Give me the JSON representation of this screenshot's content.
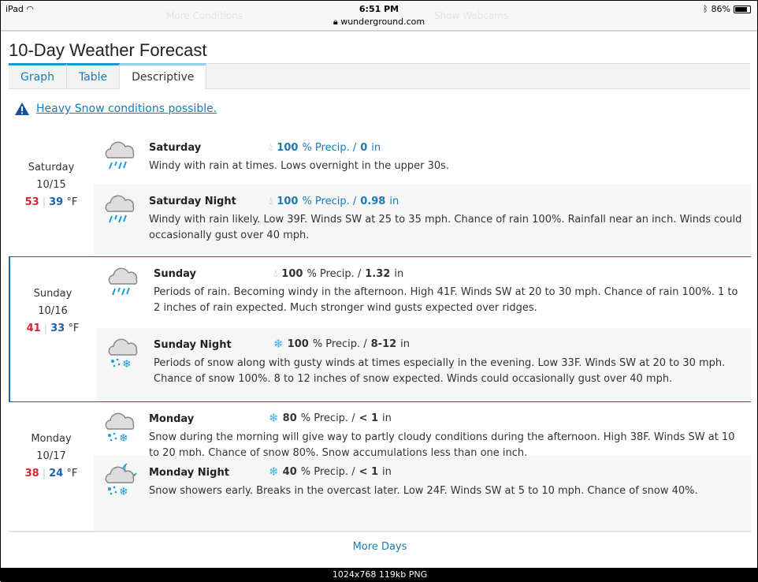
{
  "status_bar": {
    "device": "iPad",
    "time": "6:51 PM",
    "url": "wunderground.com",
    "battery": "86%",
    "battery_level": 0.86,
    "ghost_left": "More Conditions",
    "ghost_right": "Show Webcams"
  },
  "page_title": "10-Day Weather Forecast",
  "tabs": [
    {
      "label": "Graph"
    },
    {
      "label": "Table"
    },
    {
      "label": "Descriptive",
      "active": true
    }
  ],
  "alert": {
    "text": "Heavy Snow conditions possible.",
    "icon": "warning-triangle-icon"
  },
  "colors": {
    "accent": "#1a7ab5",
    "high": "#d8232a",
    "low": "#1a64b5",
    "rain": "#1a9bd7"
  },
  "days": [
    {
      "name": "Saturday",
      "date": "10/15",
      "high": "53",
      "low": "39",
      "unit": "°F",
      "selected": false,
      "periods": [
        {
          "name": "Saturday",
          "icon": "rain",
          "precip_icon": "raindrop-icon",
          "pct": "100",
          "pct_label": "% Precip. /",
          "amount": "0",
          "amount_unit": "in",
          "precip_color": "#1a7ab5",
          "desc": "Windy with rain at times. Lows overnight in the upper 30s."
        },
        {
          "name": "Saturday Night",
          "icon": "rain",
          "precip_icon": "raindrop-icon",
          "pct": "100",
          "pct_label": "% Precip. /",
          "amount": "0.98",
          "amount_unit": "in",
          "precip_color": "#1a7ab5",
          "desc": "Windy with rain likely. Low 39F. Winds SW at 25 to 35 mph. Chance of rain 100%. Rainfall near an inch. Winds could occasionally gust over 40 mph."
        }
      ]
    },
    {
      "name": "Sunday",
      "date": "10/16",
      "high": "41",
      "low": "33",
      "unit": "°F",
      "selected": true,
      "periods": [
        {
          "name": "Sunday",
          "icon": "rain",
          "precip_icon": "raindrop-icon",
          "pct": "100",
          "pct_label": "% Precip. /",
          "amount": "1.32",
          "amount_unit": "in",
          "precip_color": "#333333",
          "desc": "Periods of rain. Becoming windy in the afternoon. High 41F. Winds SW at 20 to 30 mph. Chance of rain 100%. 1 to 2 inches of rain expected. Much stronger wind gusts expected over ridges."
        },
        {
          "name": "Sunday Night",
          "icon": "snow",
          "precip_icon": "snowflake-icon",
          "pct": "100",
          "pct_label": "% Precip. /",
          "amount": "8-12",
          "amount_unit": "in",
          "precip_color": "#333333",
          "desc": "Periods of snow along with gusty winds at times especially in the evening. Low 33F. Winds SW at 20 to 30 mph. Chance of snow 100%. 8 to 12 inches of snow expected. Winds could occasionally gust over 40 mph."
        }
      ]
    },
    {
      "name": "Monday",
      "date": "10/17",
      "high": "38",
      "low": "24",
      "unit": "°F",
      "selected": false,
      "periods": [
        {
          "name": "Monday",
          "icon": "snow",
          "precip_icon": "snowflake-icon",
          "pct": "80",
          "pct_label": "% Precip. /",
          "amount": "< 1",
          "amount_unit": "in",
          "precip_color": "#333333",
          "desc": "Snow during the morning will give way to partly cloudy conditions during the afternoon. High 38F. Winds SW at 10 to 20 mph. Chance of snow 80%. Snow accumulations less than one inch."
        },
        {
          "name": "Monday Night",
          "icon": "snow-night",
          "precip_icon": "snowflake-icon",
          "pct": "40",
          "pct_label": "% Precip. /",
          "amount": "< 1",
          "amount_unit": "in",
          "precip_color": "#333333",
          "desc": "Snow showers early. Breaks in the overcast later. Low 24F. Winds SW at 5 to 10 mph. Chance of snow 40%."
        }
      ]
    }
  ],
  "more_days": "More Days",
  "footer": "1024x768 119kb PNG"
}
